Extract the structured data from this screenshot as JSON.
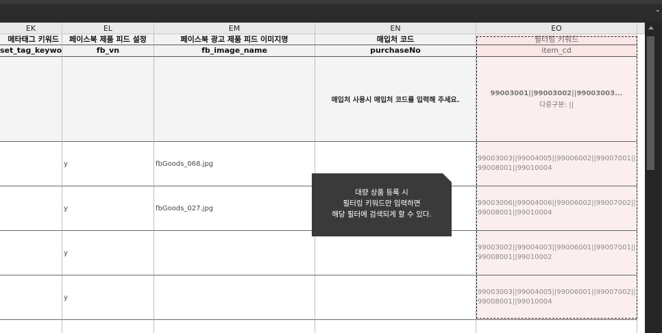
{
  "columns": [
    "EK",
    "EL",
    "EM",
    "EN",
    "EO"
  ],
  "header_korean": [
    "메타태그 키워드",
    "페이스북 제품 피드 설정",
    "페이스북 광고 제품 피드 이미지명",
    "매입처 코드",
    "필터링 키워드"
  ],
  "header_fields": [
    "set_tag_keyword",
    "fb_vn",
    "fb_image_name",
    "purchaseNo",
    "item_cd"
  ],
  "descriptions": {
    "purchase": "매입처 사용시 매입처 코드를 입력해 주세요.",
    "filter_line1": "99003001||99003002||99003003...",
    "filter_line2": "다중구분: ||"
  },
  "rows": [
    {
      "fb_vn": "y",
      "fb_image_name": "fbGoods_068.jpg",
      "item_cd": "99003003||99004005||99006002||99007001||99008001||99010004"
    },
    {
      "fb_vn": "y",
      "fb_image_name": "fbGoods_027.jpg",
      "item_cd": "99003006||99004006||99006002||99007002||99008001||99010004"
    },
    {
      "fb_vn": "y",
      "fb_image_name": "",
      "item_cd": "99003002||99004003||99006001||99007001||99008001||99010002"
    },
    {
      "fb_vn": "y",
      "fb_image_name": "",
      "item_cd": "99003003||99004005||99006001||99007002||99008001||99010004"
    }
  ],
  "tooltip": "대량 상품 등록 시\n필터링 키워드만 입력하면\n해당 필터에 검색되게 할 수 있다.",
  "dropdown_icon": "chevron-down-icon",
  "colors": {
    "highlight": "#fbeeee",
    "tooltip_bg": "#3a3a3a"
  }
}
